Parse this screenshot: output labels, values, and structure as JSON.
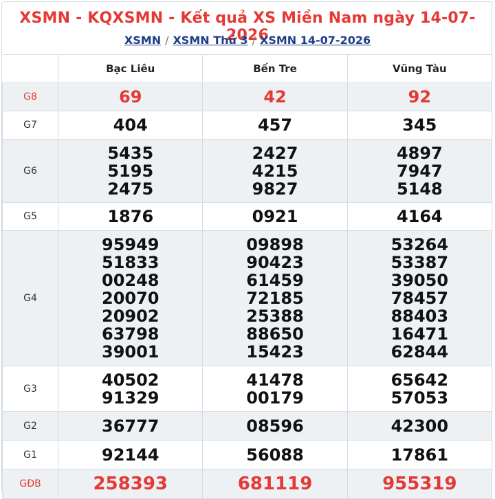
{
  "title": "XSMN - KQXSMN - Kết quả XS Miền Nam ngày 14-07-2026",
  "breadcrumbs": [
    {
      "label": "XSMN"
    },
    {
      "label": "XSMN Thứ 3"
    },
    {
      "label": "XSMN 14-07-2026"
    }
  ],
  "separator": "/",
  "provinces": [
    "Bạc Liêu",
    "Bến Tre",
    "Vũng Tàu"
  ],
  "colors": {
    "accent_red": "#e53935",
    "link_blue": "#1f3e8a",
    "row_shade": "#eef1f4"
  },
  "prizes": [
    {
      "label": "G8",
      "values": [
        [
          "69"
        ],
        [
          "42"
        ],
        [
          "92"
        ]
      ]
    },
    {
      "label": "G7",
      "values": [
        [
          "404"
        ],
        [
          "457"
        ],
        [
          "345"
        ]
      ]
    },
    {
      "label": "G6",
      "values": [
        [
          "5435",
          "5195",
          "2475"
        ],
        [
          "2427",
          "4215",
          "9827"
        ],
        [
          "4897",
          "7947",
          "5148"
        ]
      ]
    },
    {
      "label": "G5",
      "values": [
        [
          "1876"
        ],
        [
          "0921"
        ],
        [
          "4164"
        ]
      ]
    },
    {
      "label": "G4",
      "values": [
        [
          "95949",
          "51833",
          "00248",
          "20070",
          "20902",
          "63798",
          "39001"
        ],
        [
          "09898",
          "90423",
          "61459",
          "72185",
          "25388",
          "88650",
          "15423"
        ],
        [
          "53264",
          "53387",
          "39050",
          "78457",
          "88403",
          "16471",
          "62844"
        ]
      ]
    },
    {
      "label": "G3",
      "values": [
        [
          "40502",
          "91329"
        ],
        [
          "41478",
          "00179"
        ],
        [
          "65642",
          "57053"
        ]
      ]
    },
    {
      "label": "G2",
      "values": [
        [
          "36777"
        ],
        [
          "08596"
        ],
        [
          "42300"
        ]
      ]
    },
    {
      "label": "G1",
      "values": [
        [
          "92144"
        ],
        [
          "56088"
        ],
        [
          "17861"
        ]
      ]
    },
    {
      "label": "GĐB",
      "values": [
        [
          "258393"
        ],
        [
          "681119"
        ],
        [
          "955319"
        ]
      ]
    }
  ]
}
